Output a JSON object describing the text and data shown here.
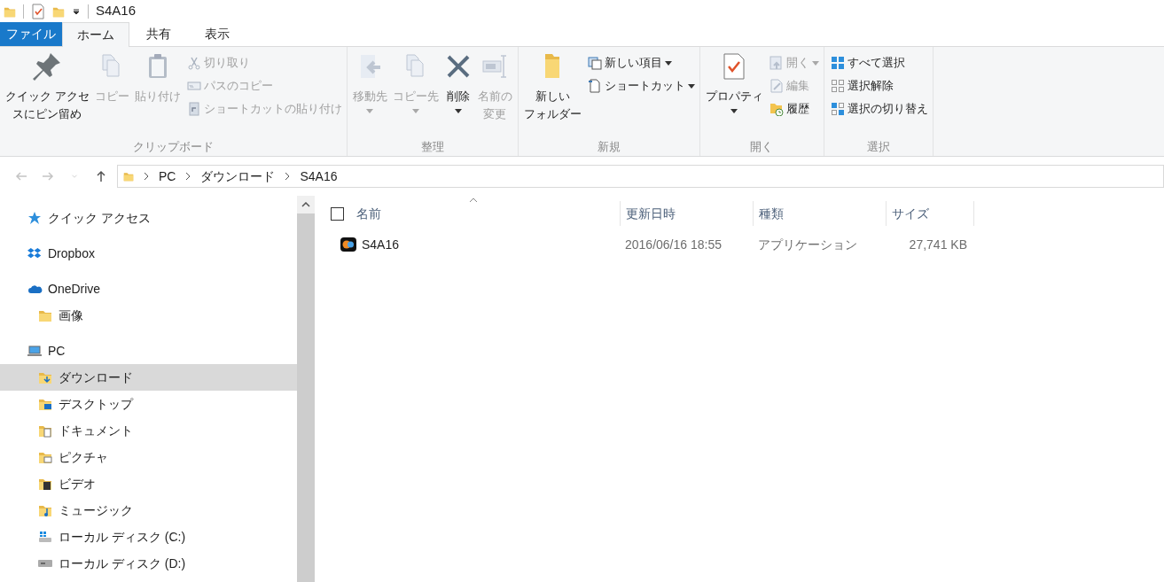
{
  "title_bar": {
    "title": "S4A16"
  },
  "ribbon_tabs": [
    {
      "label": "ファイル",
      "kind": "file",
      "selected": false
    },
    {
      "label": "ホーム",
      "kind": "tab",
      "selected": true
    },
    {
      "label": "共有",
      "kind": "tab",
      "selected": false
    },
    {
      "label": "表示",
      "kind": "tab",
      "selected": false
    }
  ],
  "ribbon_groups": [
    {
      "label": "クリップボード",
      "items": [
        {
          "kind": "large",
          "lines": [
            "クイック アクセ",
            "スにピン留め"
          ],
          "disabled": false,
          "dropdown": false
        },
        {
          "kind": "large",
          "lines": [
            "コピー"
          ],
          "disabled": true,
          "dropdown": false
        },
        {
          "kind": "large",
          "lines": [
            "貼り付け"
          ],
          "disabled": true,
          "dropdown": false
        },
        {
          "kind": "small",
          "lines": [
            "切り取り"
          ],
          "disabled": true,
          "dropdown": false
        },
        {
          "kind": "small",
          "lines": [
            "パスのコピー"
          ],
          "disabled": true,
          "dropdown": false
        },
        {
          "kind": "small",
          "lines": [
            "ショートカットの貼り付け"
          ],
          "disabled": true,
          "dropdown": false
        }
      ]
    },
    {
      "label": "整理",
      "items": [
        {
          "kind": "large",
          "lines": [
            "移動先"
          ],
          "disabled": true,
          "dropdown": true
        },
        {
          "kind": "large",
          "lines": [
            "コピー先"
          ],
          "disabled": true,
          "dropdown": true
        },
        {
          "kind": "large",
          "lines": [
            "削除"
          ],
          "disabled": false,
          "dropdown": true
        },
        {
          "kind": "large",
          "lines": [
            "名前の",
            "変更"
          ],
          "disabled": true,
          "dropdown": false
        }
      ]
    },
    {
      "label": "新規",
      "items": [
        {
          "kind": "large",
          "lines": [
            "新しい",
            "フォルダー"
          ],
          "disabled": false,
          "dropdown": false
        },
        {
          "kind": "small",
          "lines": [
            "新しい項目"
          ],
          "disabled": false,
          "dropdown": true
        },
        {
          "kind": "small",
          "lines": [
            "ショートカット"
          ],
          "disabled": false,
          "dropdown": true
        }
      ]
    },
    {
      "label": "開く",
      "items": [
        {
          "kind": "large",
          "lines": [
            "プロパティ"
          ],
          "disabled": false,
          "dropdown": true
        },
        {
          "kind": "small",
          "lines": [
            "開く"
          ],
          "disabled": true,
          "dropdown": true
        },
        {
          "kind": "small",
          "lines": [
            "編集"
          ],
          "disabled": true,
          "dropdown": false
        },
        {
          "kind": "small",
          "lines": [
            "履歴"
          ],
          "disabled": false,
          "dropdown": false
        }
      ]
    },
    {
      "label": "選択",
      "items": [
        {
          "kind": "small",
          "lines": [
            "すべて選択"
          ],
          "disabled": false,
          "dropdown": false
        },
        {
          "kind": "small",
          "lines": [
            "選択解除"
          ],
          "disabled": false,
          "dropdown": false
        },
        {
          "kind": "small",
          "lines": [
            "選択の切り替え"
          ],
          "disabled": false,
          "dropdown": false
        }
      ]
    }
  ],
  "navigation_buttons": [
    {
      "kind": "back",
      "disabled": true
    },
    {
      "kind": "forward",
      "disabled": true
    },
    {
      "kind": "recent",
      "disabled": true
    },
    {
      "kind": "up",
      "disabled": false
    }
  ],
  "address_bar": {
    "path": [
      "PC",
      "ダウンロード",
      "S4A16"
    ]
  },
  "sidebar": {
    "items": [
      {
        "label": "クイック アクセス",
        "kind": "star",
        "selected": false
      },
      {
        "label": "Dropbox",
        "kind": "dropbox",
        "selected": false
      },
      {
        "label": "OneDrive",
        "kind": "cloud",
        "selected": false,
        "children": [
          {
            "label": "画像",
            "kind": "folder",
            "selected": false
          }
        ]
      },
      {
        "label": "PC",
        "kind": "pc",
        "selected": false,
        "children": [
          {
            "label": "ダウンロード",
            "kind": "downloads",
            "selected": true
          },
          {
            "label": "デスクトップ",
            "kind": "desktop",
            "selected": false
          },
          {
            "label": "ドキュメント",
            "kind": "documents",
            "selected": false
          },
          {
            "label": "ピクチャ",
            "kind": "pictures",
            "selected": false
          },
          {
            "label": "ビデオ",
            "kind": "videos",
            "selected": false
          },
          {
            "label": "ミュージック",
            "kind": "music",
            "selected": false
          },
          {
            "label": "ローカル ディスク (C:)",
            "kind": "systemdrive",
            "selected": false
          },
          {
            "label": "ローカル ディスク (D:)",
            "kind": "drive",
            "selected": false
          }
        ]
      }
    ]
  },
  "file_list": {
    "select_all": {
      "checked": false
    },
    "columns": [
      {
        "label": "名前",
        "sorted": true
      },
      {
        "label": "更新日時",
        "sorted": false
      },
      {
        "label": "種類",
        "sorted": false
      },
      {
        "label": "サイズ",
        "sorted": false
      }
    ],
    "rows": [
      {
        "name": "S4A16",
        "date": "2016/06/16 18:55",
        "type": "アプリケーション",
        "size": "27,741 KB",
        "selected": false
      }
    ]
  }
}
